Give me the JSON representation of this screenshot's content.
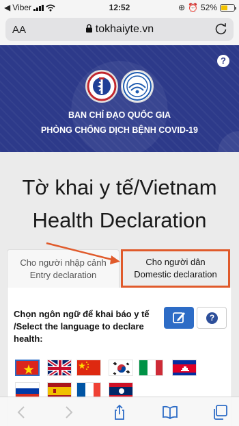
{
  "status": {
    "carrier": "Viber",
    "time": "12:52",
    "battery": "52%",
    "battery_level": 0.52
  },
  "browser": {
    "text_size": "AA",
    "url": "tokhaiyte.vn"
  },
  "banner": {
    "line1": "BAN CHỈ ĐẠO QUỐC GIA",
    "line2": "PHÒNG CHỐNG DỊCH BỆNH COVID-19",
    "help": "?"
  },
  "title": {
    "line1": "Tờ khai y tế/Vietnam",
    "line2": "Health Declaration"
  },
  "tabs": {
    "entry": {
      "line1": "Cho người nhập cảnh",
      "line2": "Entry declaration"
    },
    "domestic": {
      "line1": "Cho người dân",
      "line2": "Domestic declaration"
    }
  },
  "language": {
    "prompt": "Chọn ngôn ngữ để khai báo y tế /Select the language to declare health:",
    "help": "?",
    "flags": [
      "Vietnam",
      "United Kingdom",
      "China",
      "South Korea",
      "Italy",
      "Cambodia",
      "Russia",
      "Spain",
      "France",
      "Laos"
    ]
  },
  "colors": {
    "banner": "#2d3a8a",
    "highlight": "#e05a2b",
    "primary": "#2d6cc6"
  }
}
